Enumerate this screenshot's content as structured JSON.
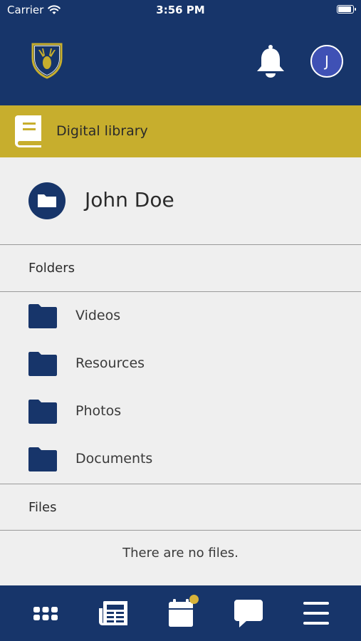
{
  "status_bar": {
    "carrier": "Carrier",
    "time": "3:56 PM"
  },
  "header": {
    "logo_icon": "stag-shield-logo",
    "bell_icon": "bell-icon",
    "avatar_letter": "J"
  },
  "banner": {
    "title": "Digital library",
    "icon": "book-icon"
  },
  "user": {
    "name": "John Doe",
    "icon": "folder-icon"
  },
  "sections": {
    "folders_label": "Folders",
    "files_label": "Files"
  },
  "folders": [
    {
      "label": "Videos"
    },
    {
      "label": "Resources"
    },
    {
      "label": "Photos"
    },
    {
      "label": "Documents"
    }
  ],
  "files": {
    "empty_text": "There are no files."
  },
  "tabbar": {
    "items": [
      "apps-grid-icon",
      "newspaper-icon",
      "calendar-icon",
      "chat-icon",
      "menu-icon"
    ],
    "calendar_badge": true
  },
  "colors": {
    "primary": "#17356a",
    "accent": "#c7ae2d",
    "avatar": "#3f51b5",
    "badge": "#d8b33a",
    "background": "#efefef"
  }
}
